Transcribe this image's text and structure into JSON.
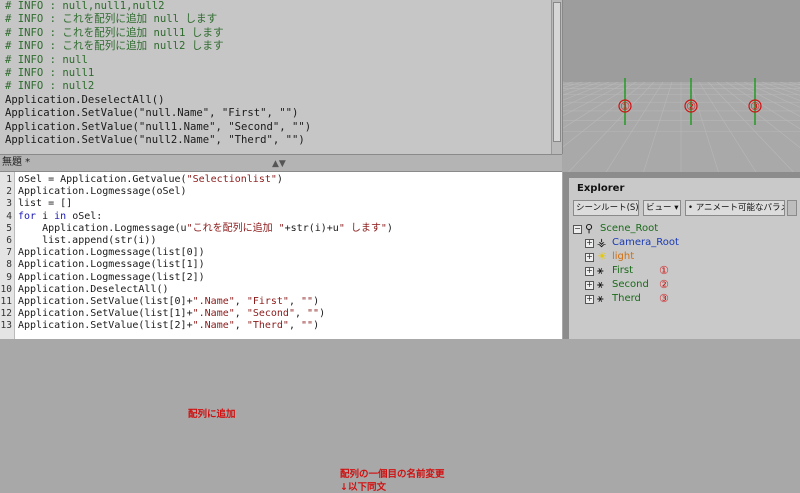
{
  "log": {
    "lines": [
      {
        "text": "# INFO : null,null1,null2",
        "kind": "info"
      },
      {
        "text": "# INFO : これを配列に追加 null します",
        "kind": "info"
      },
      {
        "text": "# INFO : これを配列に追加 null1 します",
        "kind": "info"
      },
      {
        "text": "# INFO : これを配列に追加 null2 します",
        "kind": "info"
      },
      {
        "text": "# INFO : null",
        "kind": "info"
      },
      {
        "text": "# INFO : null1",
        "kind": "info"
      },
      {
        "text": "# INFO : null2",
        "kind": "info"
      },
      {
        "text": "Application.DeselectAll()",
        "kind": "cmd"
      },
      {
        "text": "Application.SetValue(\"null.Name\", \"First\", \"\")",
        "kind": "cmd"
      },
      {
        "text": "Application.SetValue(\"null1.Name\", \"Second\", \"\")",
        "kind": "cmd"
      },
      {
        "text": "Application.SetValue(\"null2.Name\", \"Therd\", \"\")",
        "kind": "cmd"
      }
    ]
  },
  "editor": {
    "title": "無題 *",
    "lines": [
      {
        "num": "1",
        "segs": [
          {
            "t": "oSel = Application.Getvalue("
          },
          {
            "t": "\"Selectionlist\"",
            "c": "st"
          },
          {
            "t": ")"
          }
        ]
      },
      {
        "num": "2",
        "segs": [
          {
            "t": "Application.Logmessage(oSel)"
          }
        ]
      },
      {
        "num": "3",
        "segs": [
          {
            "t": "list = []"
          }
        ]
      },
      {
        "num": "4",
        "segs": [
          {
            "t": "for",
            "c": "kw"
          },
          {
            "t": " i "
          },
          {
            "t": "in",
            "c": "kw"
          },
          {
            "t": " oSel:"
          }
        ]
      },
      {
        "num": "5",
        "segs": [
          {
            "t": "    Application.Logmessage(u"
          },
          {
            "t": "\"これを配列に追加 \"",
            "c": "st"
          },
          {
            "t": "+str(i)+u"
          },
          {
            "t": "\" します\"",
            "c": "st"
          },
          {
            "t": ")"
          }
        ]
      },
      {
        "num": "6",
        "segs": [
          {
            "t": "    list.append(str(i))"
          }
        ]
      },
      {
        "num": "7",
        "segs": [
          {
            "t": "Application.Logmessage(list[0])"
          }
        ]
      },
      {
        "num": "8",
        "segs": [
          {
            "t": "Application.Logmessage(list[1])"
          }
        ]
      },
      {
        "num": "9",
        "segs": [
          {
            "t": "Application.Logmessage(list[2])"
          }
        ]
      },
      {
        "num": "10",
        "segs": [
          {
            "t": "Application.DeselectAll()"
          }
        ]
      },
      {
        "num": "11",
        "segs": [
          {
            "t": "Application.SetValue(list[0]+"
          },
          {
            "t": "\".Name\"",
            "c": "st"
          },
          {
            "t": ", "
          },
          {
            "t": "\"First\"",
            "c": "st"
          },
          {
            "t": ", "
          },
          {
            "t": "\"\"",
            "c": "st"
          },
          {
            "t": ")"
          }
        ]
      },
      {
        "num": "12",
        "segs": [
          {
            "t": "Application.SetValue(list[1]+"
          },
          {
            "t": "\".Name\"",
            "c": "st"
          },
          {
            "t": ", "
          },
          {
            "t": "\"Second\"",
            "c": "st"
          },
          {
            "t": ", "
          },
          {
            "t": "\"\"",
            "c": "st"
          },
          {
            "t": ")"
          }
        ]
      },
      {
        "num": "13",
        "segs": [
          {
            "t": "Application.SetValue(list[2]+"
          },
          {
            "t": "\".Name\"",
            "c": "st"
          },
          {
            "t": ", "
          },
          {
            "t": "\"Therd\"",
            "c": "st"
          },
          {
            "t": ", "
          },
          {
            "t": "\"\"",
            "c": "st"
          },
          {
            "t": ")"
          }
        ]
      }
    ],
    "annotations": {
      "add_to_array": "配列に追加",
      "rename_note": "配列の一個目の名前変更",
      "same_below": "↓以下同文"
    }
  },
  "viewport": {
    "markers": [
      "①",
      "②",
      "③"
    ],
    "grid_color": "#b8b8b8",
    "marker_color": "#d01010",
    "axis_color": "#1a9a1a"
  },
  "explorer": {
    "title": "Explorer",
    "toolbar": {
      "scope": "シーンルート(S)",
      "view": "ビュー",
      "animatable": "• アニメート可能なパラメ"
    },
    "tree": [
      {
        "label": "Scene_Root",
        "icon": "scene-root-icon",
        "color": "#1a6a1a",
        "mark": ""
      },
      {
        "label": "Camera_Root",
        "icon": "camera-root-icon",
        "color": "#1a3ab4",
        "mark": ""
      },
      {
        "label": "light",
        "icon": "light-icon",
        "color": "#d07010",
        "mark": ""
      },
      {
        "label": "First",
        "icon": "null-icon",
        "color": "#1a6a1a",
        "mark": "①"
      },
      {
        "label": "Second",
        "icon": "null-icon",
        "color": "#1a6a1a",
        "mark": "②"
      },
      {
        "label": "Therd",
        "icon": "null-icon",
        "color": "#1a6a1a",
        "mark": "③"
      }
    ]
  }
}
